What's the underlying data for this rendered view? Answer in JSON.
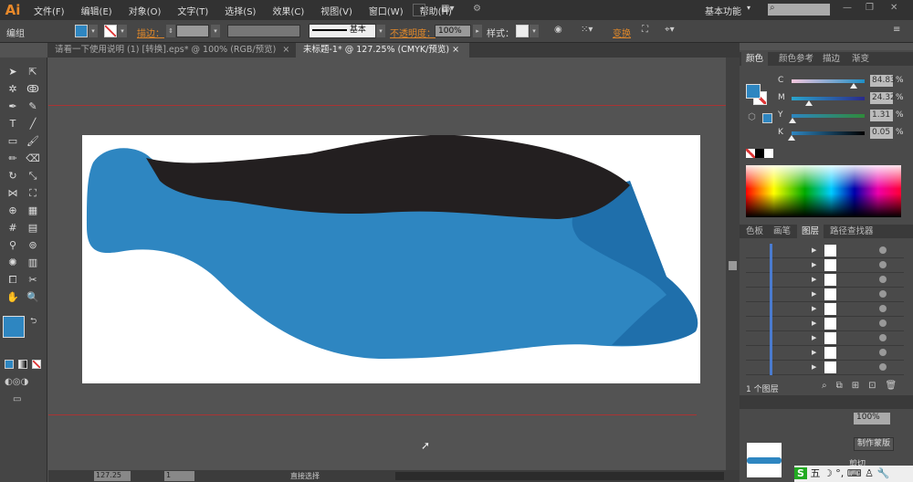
{
  "app": {
    "logo": "Ai",
    "workspace": "基本功能",
    "search_placeholder": ""
  },
  "menu": [
    "文件(F)",
    "编辑(E)",
    "对象(O)",
    "文字(T)",
    "选择(S)",
    "效果(C)",
    "视图(V)",
    "窗口(W)",
    "帮助(H)"
  ],
  "window_controls": [
    "—",
    "❐",
    "✕"
  ],
  "control_bar": {
    "selection": "编组",
    "fill_color": "#2e86c1",
    "stroke_label": "描边：",
    "stroke_profile": "基本",
    "opacity_label": "不透明度：",
    "opacity_value": "100%",
    "style_label": "样式：",
    "transform_label": "变换"
  },
  "doc_tabs": [
    {
      "label": "请看一下使用说明 (1) [转换].eps* @ 100% (RGB/预览)",
      "active": false
    },
    {
      "label": "未标题-1* @ 127.25% (CMYK/预览)",
      "active": true
    }
  ],
  "color_panel": {
    "tabs": [
      "颜色",
      "颜色参考",
      "描边",
      "渐变"
    ],
    "fill_color": "#2e86c1",
    "sliders": [
      {
        "label": "C",
        "value": "84.83",
        "percent": 84.83,
        "gradient": "linear-gradient(90deg,#f4c6dd,#1e8fc6)"
      },
      {
        "label": "M",
        "value": "24.32",
        "percent": 24.32,
        "gradient": "linear-gradient(90deg,#2aa4cc,#2a2a8a)"
      },
      {
        "label": "Y",
        "value": "1.31",
        "percent": 1.31,
        "gradient": "linear-gradient(90deg,#2e86c1,#2f8a3a)"
      },
      {
        "label": "K",
        "value": "0.05",
        "percent": 0.05,
        "gradient": "linear-gradient(90deg,#2e86c1,#000)"
      }
    ],
    "unit": "%"
  },
  "layers_panel": {
    "tabs": [
      "色板",
      "画笔",
      "图层",
      "路径查找器"
    ],
    "row_count": 9,
    "footer": "1 个图层"
  },
  "lower_panel": {
    "opacity_value": "100%",
    "mask_button": "制作蒙版",
    "clip_label": "剪切"
  },
  "status_bar": {
    "zoom": "127.25",
    "page": "1",
    "tool": "直接选择"
  },
  "artwork": {
    "blue": "#2e86c1",
    "dark_blue": "#1f6fab",
    "black": "#231f20"
  },
  "ime": {
    "label": "五"
  }
}
